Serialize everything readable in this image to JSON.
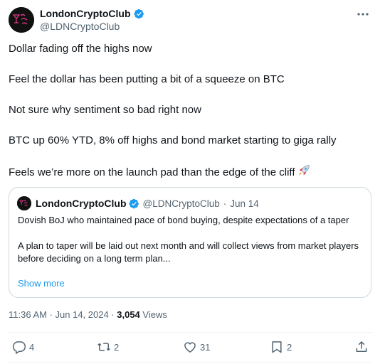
{
  "author": {
    "name": "LondonCryptoClub",
    "handle": "@LDNCryptoClub",
    "avatar_text": "London Crypto Club"
  },
  "tweet": {
    "lines": [
      "Dollar fading off the highs now",
      "Feel the dollar has been putting a bit of a squeeze on BTC",
      "Not sure why sentiment so bad right now",
      "BTC up 60% YTD, 8% off highs and bond market starting to giga rally",
      "Feels we’re more on the launch pad than the edge of the cliff"
    ]
  },
  "quote": {
    "name": "LondonCryptoClub",
    "handle": "@LDNCryptoClub",
    "separator": "·",
    "date": "Jun 14",
    "para1": "Dovish BoJ who maintained pace of bond buying, despite expectations of a taper",
    "para2": "A plan to taper will be laid out next month and will collect views from market players before deciding on a long term plan...",
    "show_more": "Show more"
  },
  "meta": {
    "time": "11:36 AM · Jun 14, 2024 · ",
    "views_count": "3,054",
    "views_label": " Views"
  },
  "actions": {
    "replies": "4",
    "reposts": "2",
    "likes": "31",
    "bookmarks": "2"
  },
  "colors": {
    "verified": "#1d9bf0",
    "link": "#1d9bf0",
    "secondary_text": "#536471",
    "avatar_text": "#e23a8c"
  },
  "icons": [
    "verified-badge-icon",
    "more-icon",
    "rocket-icon",
    "reply-icon",
    "repost-icon",
    "like-icon",
    "bookmark-icon",
    "share-icon"
  ]
}
